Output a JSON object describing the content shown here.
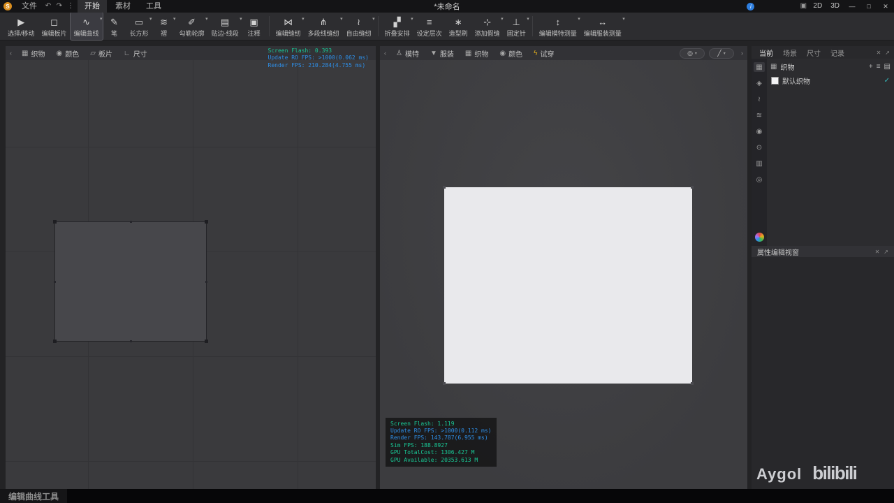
{
  "colors": {
    "logo-orange": "#db8f1f",
    "info-blue": "#2e7fe0",
    "debug-green": "#19c795",
    "debug-blue": "#2e8fe8",
    "check-teal": "#36b8ba",
    "tryon-yellow": "#e2ae1c"
  },
  "icons": {
    "undo": "↶",
    "redo": "↷",
    "more": "⋮",
    "info": "i",
    "grid": "▣",
    "minimize": "—",
    "maximize": "□",
    "close": "✕",
    "collapse_left": "‹",
    "collapse_right": "›",
    "view_orbit": "◎",
    "view_light": "╱",
    "plus": "+",
    "list": "≡",
    "grid_view": "▤",
    "check": "✓",
    "panel_close": "✕",
    "panel_float": "↗"
  },
  "titlebar": {
    "logo_letter": "S",
    "menu_file": "文件",
    "tabs": [
      {
        "label": "开始"
      },
      {
        "label": "素材"
      },
      {
        "label": "工具"
      }
    ],
    "title": "*未命名",
    "view_2d": "2D",
    "view_3d": "3D"
  },
  "toolbar": {
    "tools": [
      {
        "label": "选择/移动",
        "icon": "▶"
      },
      {
        "label": "编辑板片",
        "icon": "◻"
      },
      {
        "label": "编辑曲线",
        "icon": "∿"
      },
      {
        "label": "笔",
        "icon": "✎"
      },
      {
        "label": "长方形",
        "icon": "▭"
      },
      {
        "label": "褶",
        "icon": "≋"
      },
      {
        "label": "勾勒轮廓",
        "icon": "✐"
      },
      {
        "label": "贴边-线段",
        "icon": "▤"
      },
      {
        "label": "注释",
        "icon": "▣"
      },
      {
        "label": "编辑缝纫",
        "icon": "⋈"
      },
      {
        "label": "多段线缝纫",
        "icon": "⋔"
      },
      {
        "label": "自由缝纫",
        "icon": "≀"
      },
      {
        "label": "折叠安排",
        "icon": "▞"
      },
      {
        "label": "设定层次",
        "icon": "≡"
      },
      {
        "label": "造型刷",
        "icon": "∗"
      },
      {
        "label": "添加假缝",
        "icon": "⊹"
      },
      {
        "label": "固定针",
        "icon": "⊥"
      },
      {
        "label": "编辑模特测量",
        "icon": "↕"
      },
      {
        "label": "编辑服装测量",
        "icon": "↔"
      }
    ]
  },
  "viewport2d": {
    "tabs": [
      {
        "label": "织物",
        "icon": "▦"
      },
      {
        "label": "颜色",
        "icon": "◉"
      },
      {
        "label": "板片",
        "icon": "▱"
      },
      {
        "label": "尺寸",
        "icon": "∟"
      }
    ],
    "debug": [
      "Screen Flash: 0.393",
      "Update RO FPS: >1000(0.062 ms)",
      "Render FPS: 210.284(4.755 ms)"
    ]
  },
  "viewport3d": {
    "tabs": [
      {
        "label": "模特",
        "icon": "♙"
      },
      {
        "label": "服装",
        "icon": "▼"
      },
      {
        "label": "织物",
        "icon": "▦"
      },
      {
        "label": "颜色",
        "icon": "◉"
      },
      {
        "label": "试穿",
        "icon": "ϟ"
      }
    ],
    "debug": [
      "Screen Flash: 1.119",
      "Update RO FPS: >1000(0.112 ms)",
      "Render FPS: 143.787(6.955 ms)",
      "Sim FPS: 188.8927",
      "GPU TotalCost: 1306.427 M",
      "GPU Available: 20353.613 M"
    ]
  },
  "right_panel": {
    "tabs": [
      {
        "label": "当前"
      },
      {
        "label": "场景"
      },
      {
        "label": "尺寸"
      },
      {
        "label": "记录"
      }
    ],
    "fabric_header": "织物",
    "fabric_item": "默认织物",
    "prop_header": "属性编辑视窗",
    "rail": [
      {
        "name": "fabric",
        "glyph": "▦"
      },
      {
        "name": "graphic",
        "glyph": "◈"
      },
      {
        "name": "topstitch",
        "glyph": "≀"
      },
      {
        "name": "puckering",
        "glyph": "≋"
      },
      {
        "name": "button",
        "glyph": "◉"
      },
      {
        "name": "zipper",
        "glyph": "⊙"
      },
      {
        "name": "binding",
        "glyph": "▥"
      },
      {
        "name": "trim",
        "glyph": "◎"
      }
    ]
  },
  "watermark": {
    "author": "Aygol",
    "logo": "bilibili"
  },
  "taskbar": {
    "status": "编辑曲线工具"
  }
}
